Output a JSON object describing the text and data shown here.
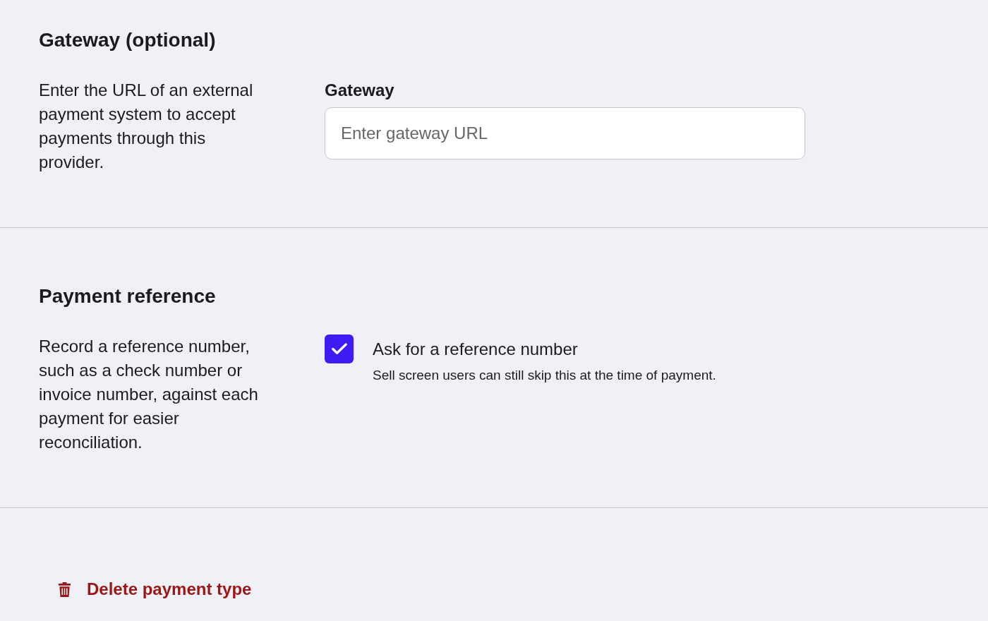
{
  "sections": [
    {
      "kind": "field",
      "title": "Gateway (optional)",
      "description": "Enter the URL of an external payment system to accept payments through this provider.",
      "field": {
        "label": "Gateway",
        "placeholder": "Enter gateway URL"
      }
    },
    {
      "kind": "checkbox",
      "title": "Payment reference",
      "description": "Record a reference number, such as a check number or invoice number, against each payment for easier reconciliation.",
      "checkbox": {
        "label": "Ask for a reference number",
        "hint": "Sell screen users can still skip this at the time of payment.",
        "checked": true
      }
    }
  ],
  "delete_button": {
    "label": "Delete payment type"
  }
}
